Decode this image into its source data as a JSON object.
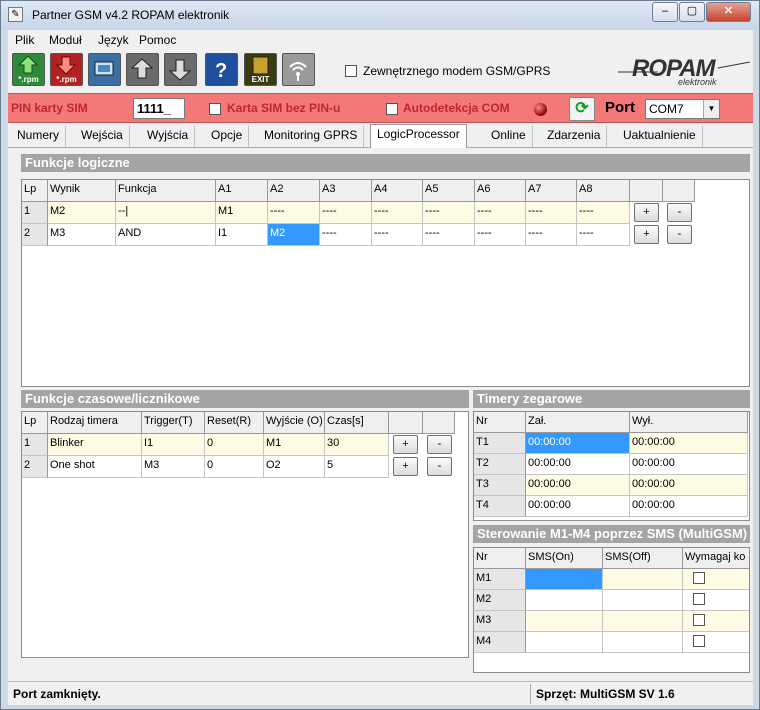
{
  "window": {
    "title": "Partner GSM v4.2 ROPAM elektronik"
  },
  "menu": [
    "Plik",
    "Moduł",
    "Język",
    "Pomoc"
  ],
  "toolbar": {
    "buttons": [
      {
        "label": "*.rpm",
        "icon": "upload-icon",
        "color": "#2e8a3a"
      },
      {
        "label": "*.rpm",
        "icon": "download-icon",
        "color": "#b22222"
      },
      {
        "label": "",
        "icon": "connect-icon",
        "color": "#3a6ea5"
      },
      {
        "label": "",
        "icon": "read-device-icon",
        "color": "#6b6b6b"
      },
      {
        "label": "",
        "icon": "write-device-icon",
        "color": "#6b6b6b"
      },
      {
        "label": "",
        "icon": "help-icon",
        "color": "#1f4f9f"
      },
      {
        "label": "EXIT",
        "icon": "exit-icon",
        "color": "#3b3b10"
      },
      {
        "label": "",
        "icon": "wireless-icon",
        "color": "#9a9a9a"
      }
    ],
    "external_modem_label": "Zewnętrznego modem GSM/GPRS",
    "logo_text": "ROPAM",
    "logo_sub": "elektronik"
  },
  "pinbar": {
    "pin_label": "PIN karty SIM",
    "pin_value": "1111_",
    "sim_no_pin_label": "Karta SIM bez PIN-u",
    "autodetect_label": "Autodetekcja COM",
    "port_label": "Port",
    "port_value": "COM7"
  },
  "tabs": [
    "Numery",
    "Wejścia",
    "Wyjścia",
    "Opcje",
    "Monitoring GPRS",
    "LogicProcessor",
    "Online",
    "Zdarzenia",
    "Uaktualnienie"
  ],
  "active_tab": "LogicProcessor",
  "logic": {
    "title": "Funkcje logiczne",
    "headers": [
      "Lp",
      "Wynik",
      "Funkcja",
      "A1",
      "A2",
      "A3",
      "A4",
      "A5",
      "A6",
      "A7",
      "A8",
      "",
      ""
    ],
    "rows": [
      [
        "1",
        "M2",
        "--|",
        "M1",
        "----",
        "----",
        "----",
        "----",
        "----",
        "----",
        "----",
        "+",
        "-"
      ],
      [
        "2",
        "M3",
        "AND",
        "I1",
        "M2",
        "----",
        "----",
        "----",
        "----",
        "----",
        "----",
        "+",
        "-"
      ]
    ]
  },
  "timers_counters": {
    "title": "Funkcje czasowe/licznikowe",
    "headers": [
      "Lp",
      "Rodzaj timera",
      "Trigger(T)",
      "Reset(R)",
      "Wyjście (O)",
      "Czas[s]",
      "",
      ""
    ],
    "rows": [
      [
        "1",
        "Blinker",
        "I1",
        "0",
        "M1",
        "30",
        "+",
        "-"
      ],
      [
        "2",
        "One shot",
        "M3",
        "0",
        "O2",
        "5",
        "+",
        "-"
      ]
    ]
  },
  "clock_timers": {
    "title": "Timery zegarowe",
    "headers": [
      "Nr",
      "Zał.",
      "Wył."
    ],
    "rows": [
      [
        "T1",
        "00:00:00",
        "00:00:00"
      ],
      [
        "T2",
        "00:00:00",
        "00:00:00"
      ],
      [
        "T3",
        "00:00:00",
        "00:00:00"
      ],
      [
        "T4",
        "00:00:00",
        "00:00:00"
      ]
    ]
  },
  "sms_control": {
    "title": "Sterowanie M1-M4 poprzez SMS (MultiGSM)",
    "headers": [
      "Nr",
      "SMS(On)",
      "SMS(Off)",
      "Wymagaj ko"
    ],
    "rows": [
      [
        "M1",
        "",
        ""
      ],
      [
        "M2",
        "",
        ""
      ],
      [
        "M3",
        "",
        ""
      ],
      [
        "M4",
        "",
        ""
      ]
    ]
  },
  "status": {
    "port_state": "Port zamknięty.",
    "hardware": "Sprzęt: MultiGSM SV 1.6"
  }
}
